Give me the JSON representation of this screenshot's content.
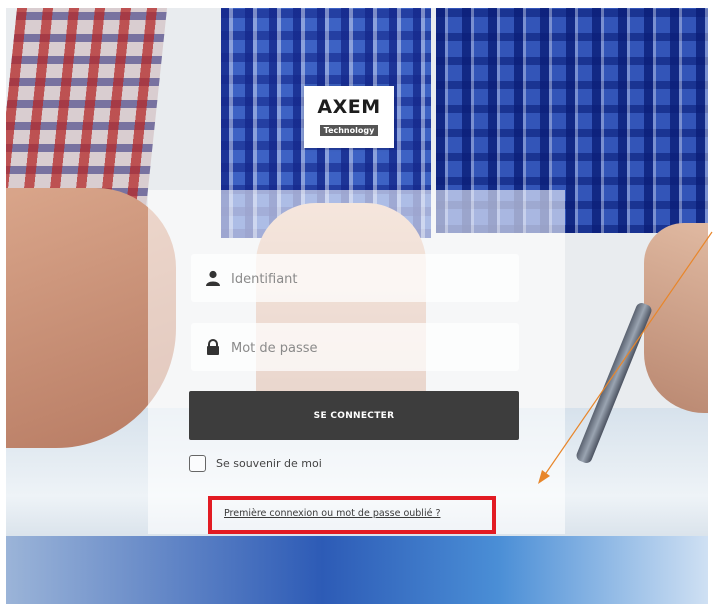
{
  "brand": {
    "name": "AXEM",
    "tagline": "Technology"
  },
  "login_form": {
    "username_placeholder": "Identifiant",
    "password_placeholder": "Mot de passe",
    "submit_label": "SE CONNECTER",
    "remember_label": "Se souvenir de moi",
    "forgot_link": "Première connexion ou mot de passe oublié ?"
  },
  "annotations": {
    "highlight_color": "#e21b23",
    "arrow_color": "#e8862a"
  },
  "icons": {
    "username": "user-icon",
    "password": "lock-icon"
  }
}
